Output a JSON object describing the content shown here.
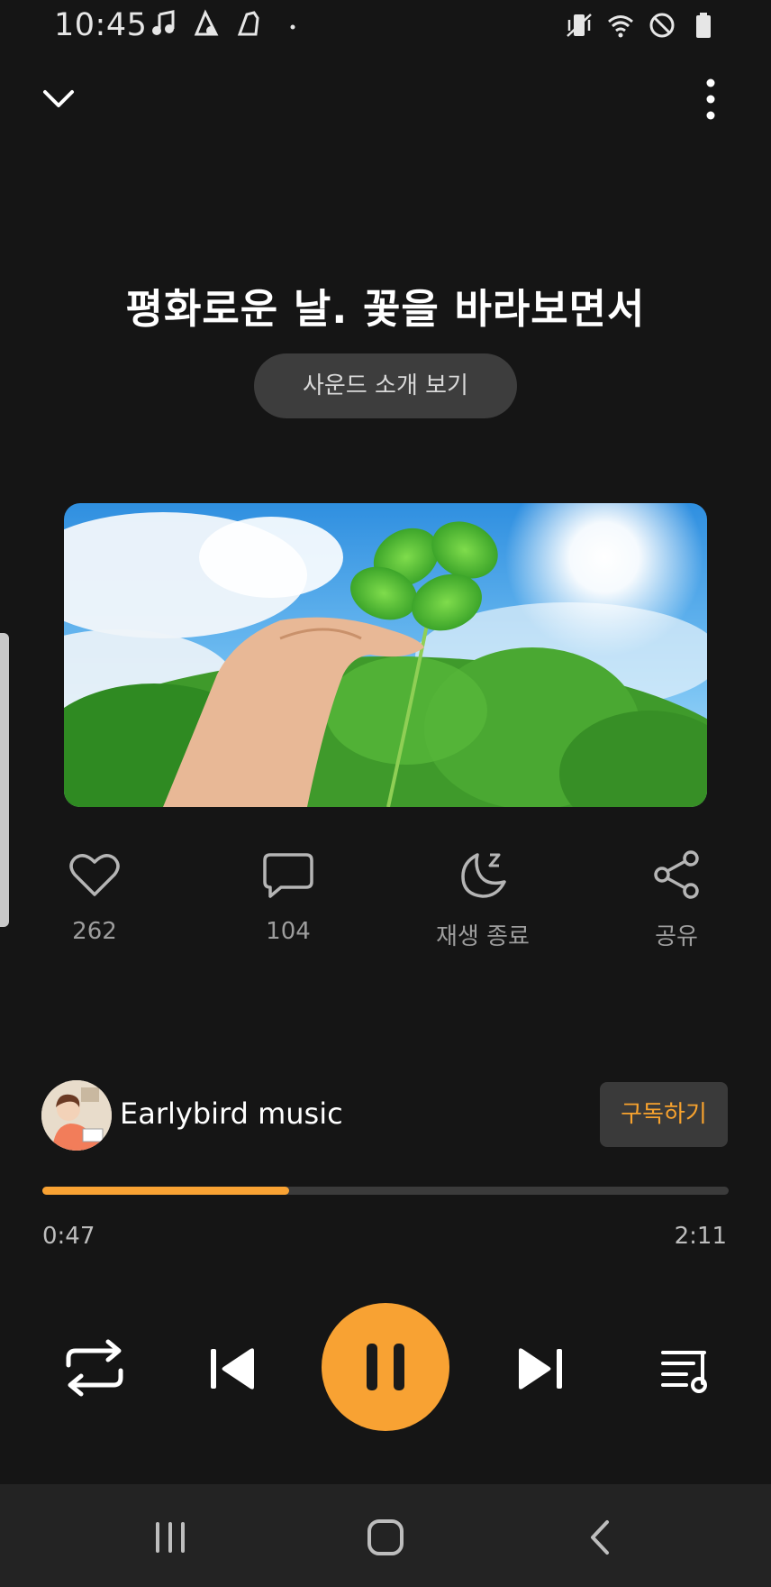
{
  "status_bar": {
    "time": "10:45",
    "left_icons": [
      "music-note-icon",
      "notification-icon",
      "notification-icon",
      "more-dot-icon"
    ],
    "right_icons": [
      "vibrate-icon",
      "wifi-icon",
      "do-not-disturb-icon",
      "battery-icon"
    ]
  },
  "track": {
    "title": "평화로운 날. 꽃을 바라보면서",
    "intro_button": "사운드 소개 보기"
  },
  "actions": {
    "like_count": "262",
    "comment_count": "104",
    "sleep_timer_label": "재생 종료",
    "share_label": "공유"
  },
  "channel": {
    "name": "Earlybird music",
    "subscribe_label": "구독하기"
  },
  "playback": {
    "current_time": "0:47",
    "total_time": "2:11",
    "progress_fraction": 0.36,
    "state": "playing"
  },
  "colors": {
    "accent": "#f8a233",
    "background": "#151515",
    "muted_text": "#9d9d9d"
  }
}
